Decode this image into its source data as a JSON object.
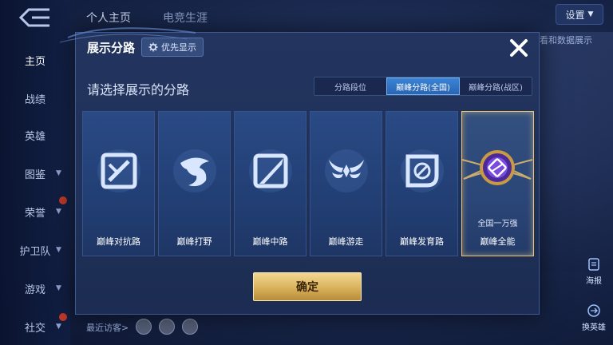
{
  "nav": {
    "items": [
      {
        "label": "主页",
        "active": true
      },
      {
        "label": "战绩"
      },
      {
        "label": "英雄"
      },
      {
        "label": "图鉴"
      },
      {
        "label": "荣誉"
      },
      {
        "label": "护卫队"
      },
      {
        "label": "游戏"
      },
      {
        "label": "社交"
      }
    ]
  },
  "header": {
    "tabs": [
      "个人主页",
      "电竞生涯"
    ],
    "settings_label": "设置",
    "data_display_text": "看和数据展示"
  },
  "dialog": {
    "title": "展示分路",
    "priority_label": "优先显示",
    "select_heading": "请选择展示的分路",
    "segments": [
      {
        "label": "分路段位"
      },
      {
        "label": "巅峰分路(全国)",
        "active": true
      },
      {
        "label": "巅峰分路(战区)"
      }
    ],
    "cards": [
      {
        "label": "巅峰对抗路",
        "icon": "sword-shield-icon"
      },
      {
        "label": "巅峰打野",
        "icon": "dragon-icon"
      },
      {
        "label": "巅峰中路",
        "icon": "blade-icon"
      },
      {
        "label": "巅峰游走",
        "icon": "wings-icon"
      },
      {
        "label": "巅峰发育路",
        "icon": "archer-icon"
      },
      {
        "label": "巅峰全能",
        "sub": "全国一万强",
        "icon": "allround-emblem-icon",
        "selected": true
      }
    ],
    "confirm_label": "确定"
  },
  "bottom": {
    "recent_visitors": "最近访客>"
  },
  "side": {
    "poster_label": "海报",
    "swap_hero_label": "换英雄"
  },
  "colors": {
    "accent_gold": "#d9b15c",
    "active_tab": "#2a64b3",
    "dialog_bg": "#21335c"
  }
}
